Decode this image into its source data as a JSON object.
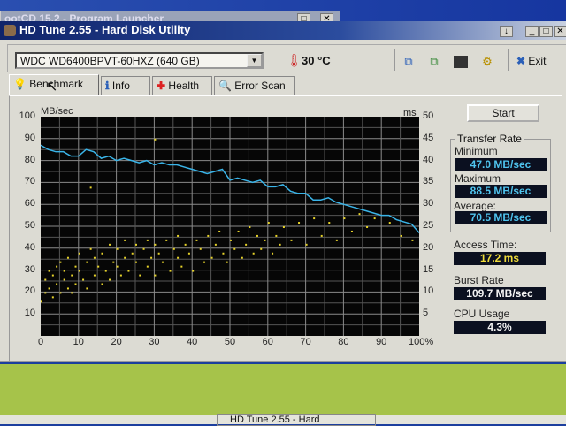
{
  "background_window": {
    "title": "ootCD 15.2 - Program Launcher"
  },
  "window": {
    "title": "HD Tune 2.55 - Hard Disk Utility"
  },
  "toolbar": {
    "drive": "WDC WD6400BPVT-60HXZ (640 GB)",
    "temperature": "30 °C",
    "exit_label": "Exit"
  },
  "tabs": [
    {
      "label": "Benchmark",
      "active": true
    },
    {
      "label": "Info"
    },
    {
      "label": "Health"
    },
    {
      "label": "Error Scan"
    }
  ],
  "results": {
    "start_label": "Start",
    "transfer_rate_title": "Transfer Rate",
    "minimum_label": "Minimum",
    "minimum": "47.0 MB/sec",
    "maximum_label": "Maximum",
    "maximum": "88.5 MB/sec",
    "average_label": "Average:",
    "average": "70.5 MB/sec",
    "access_time_label": "Access Time:",
    "access_time": "17.2 ms",
    "burst_rate_label": "Burst Rate",
    "burst_rate": "109.7 MB/sec",
    "cpu_usage_label": "CPU Usage",
    "cpu_usage": "4.3%"
  },
  "taskbar": {
    "item": "HD Tune 2.55 - Hard"
  },
  "chart_data": {
    "type": "line",
    "left_axis_label": "MB/sec",
    "right_axis_label": "ms",
    "left_ticks": [
      "100",
      "90",
      "80",
      "70",
      "60",
      "50",
      "40",
      "30",
      "20",
      "10"
    ],
    "right_ticks": [
      "50",
      "45",
      "40",
      "35",
      "30",
      "25",
      "20",
      "15",
      "10",
      "5"
    ],
    "x_ticks": [
      "0",
      "10",
      "20",
      "30",
      "40",
      "50",
      "60",
      "70",
      "80",
      "90",
      "100%"
    ],
    "xlim": [
      0,
      100
    ],
    "ylim_left": [
      0,
      100
    ],
    "ylim_right": [
      0,
      50
    ],
    "grid": true,
    "series": [
      {
        "name": "Transfer Rate",
        "axis": "left",
        "color": "#3ab4e8",
        "x": [
          0,
          2,
          4,
          6,
          8,
          10,
          12,
          14,
          16,
          18,
          20,
          22,
          24,
          26,
          28,
          30,
          32,
          34,
          36,
          38,
          40,
          42,
          44,
          46,
          48,
          50,
          52,
          54,
          56,
          58,
          60,
          62,
          64,
          66,
          68,
          70,
          72,
          74,
          76,
          78,
          80,
          82,
          84,
          86,
          88,
          90,
          92,
          94,
          96,
          98,
          100
        ],
        "y": [
          87,
          85,
          84,
          84,
          82,
          82,
          85,
          84,
          81,
          82,
          80,
          81,
          80,
          79,
          80,
          78,
          79,
          78,
          78,
          77,
          76,
          75,
          74,
          75,
          76,
          71,
          72,
          71,
          70,
          71,
          68,
          68,
          69,
          66,
          65,
          65,
          62,
          62,
          63,
          61,
          60,
          59,
          58,
          57,
          56,
          55,
          55,
          53,
          52,
          51,
          47
        ]
      },
      {
        "name": "Access Time",
        "axis": "right",
        "type": "scatter",
        "color": "#e6d22a",
        "points": [
          [
            0,
            8
          ],
          [
            1,
            13
          ],
          [
            1,
            10
          ],
          [
            2,
            15
          ],
          [
            2,
            11
          ],
          [
            3,
            9
          ],
          [
            3,
            14
          ],
          [
            4,
            12
          ],
          [
            4,
            16
          ],
          [
            5,
            10
          ],
          [
            5,
            17
          ],
          [
            6,
            13
          ],
          [
            6,
            15
          ],
          [
            7,
            11
          ],
          [
            7,
            18
          ],
          [
            8,
            14
          ],
          [
            8,
            10
          ],
          [
            9,
            16
          ],
          [
            9,
            12
          ],
          [
            10,
            15
          ],
          [
            10,
            19
          ],
          [
            11,
            13
          ],
          [
            12,
            17
          ],
          [
            12,
            11
          ],
          [
            13,
            20
          ],
          [
            14,
            14
          ],
          [
            14,
            18
          ],
          [
            15,
            16
          ],
          [
            16,
            12
          ],
          [
            16,
            19
          ],
          [
            17,
            15
          ],
          [
            18,
            21
          ],
          [
            18,
            13
          ],
          [
            19,
            17
          ],
          [
            20,
            16
          ],
          [
            20,
            20
          ],
          [
            21,
            14
          ],
          [
            22,
            18
          ],
          [
            22,
            22
          ],
          [
            23,
            15
          ],
          [
            24,
            19
          ],
          [
            25,
            17
          ],
          [
            25,
            21
          ],
          [
            26,
            14
          ],
          [
            27,
            20
          ],
          [
            28,
            16
          ],
          [
            28,
            22
          ],
          [
            29,
            18
          ],
          [
            30,
            14
          ],
          [
            30,
            21
          ],
          [
            31,
            19
          ],
          [
            32,
            17
          ],
          [
            33,
            22
          ],
          [
            34,
            15
          ],
          [
            35,
            20
          ],
          [
            36,
            18
          ],
          [
            36,
            23
          ],
          [
            37,
            16
          ],
          [
            38,
            21
          ],
          [
            39,
            19
          ],
          [
            40,
            15
          ],
          [
            41,
            22
          ],
          [
            42,
            20
          ],
          [
            43,
            17
          ],
          [
            44,
            23
          ],
          [
            45,
            18
          ],
          [
            46,
            21
          ],
          [
            47,
            24
          ],
          [
            48,
            19
          ],
          [
            49,
            17
          ],
          [
            50,
            22
          ],
          [
            51,
            20
          ],
          [
            52,
            24
          ],
          [
            53,
            18
          ],
          [
            54,
            21
          ],
          [
            55,
            25
          ],
          [
            56,
            19
          ],
          [
            57,
            23
          ],
          [
            58,
            20
          ],
          [
            59,
            22
          ],
          [
            60,
            26
          ],
          [
            61,
            19
          ],
          [
            62,
            23
          ],
          [
            63,
            21
          ],
          [
            64,
            25
          ],
          [
            66,
            22
          ],
          [
            68,
            26
          ],
          [
            70,
            21
          ],
          [
            72,
            27
          ],
          [
            74,
            23
          ],
          [
            76,
            26
          ],
          [
            78,
            22
          ],
          [
            80,
            27
          ],
          [
            82,
            24
          ],
          [
            84,
            28
          ],
          [
            86,
            25
          ],
          [
            88,
            27
          ],
          [
            92,
            26
          ],
          [
            95,
            23
          ],
          [
            98,
            22
          ],
          [
            13,
            34
          ],
          [
            30,
            45
          ]
        ]
      }
    ]
  }
}
